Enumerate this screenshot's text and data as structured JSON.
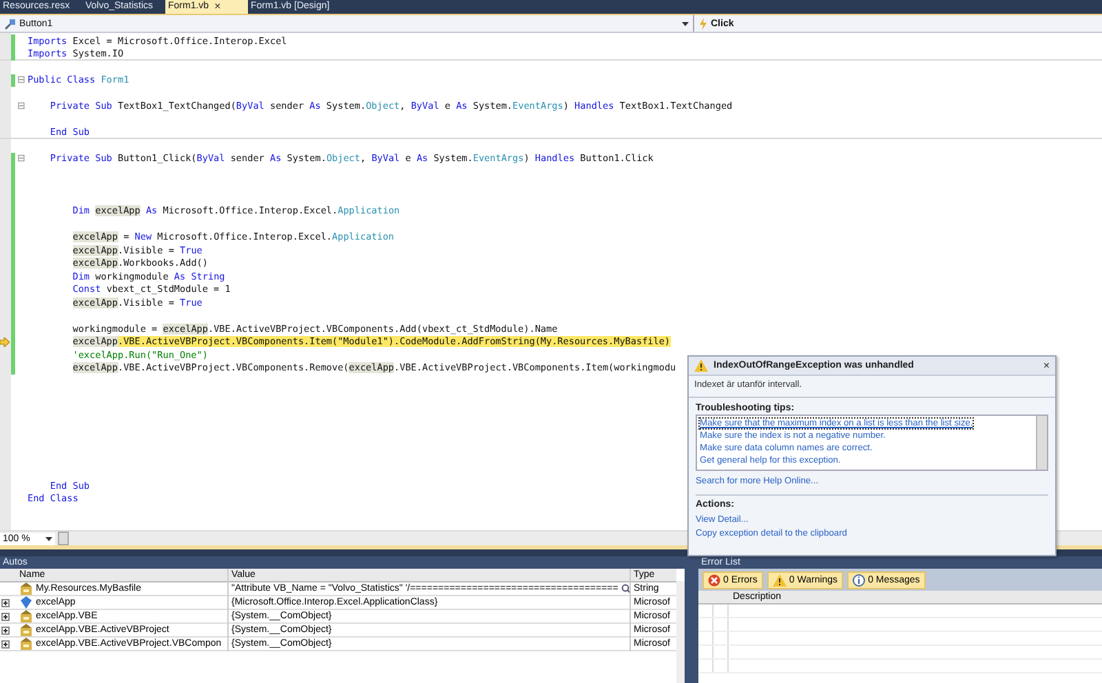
{
  "tabs": [
    {
      "label": "Resources.resx",
      "selected": false
    },
    {
      "label": "Volvo_Statistics",
      "selected": false
    },
    {
      "label": "Form1.vb",
      "selected": true,
      "close": "×"
    },
    {
      "label": "Form1.vb [Design]",
      "selected": false
    }
  ],
  "nav_bar": {
    "object": "Button1",
    "event": "Click"
  },
  "code_lines": [
    {
      "kind": "code",
      "changed": true,
      "segments": [
        {
          "kind": "kw",
          "text": "Imports"
        },
        {
          "kind": "plain",
          "text": " Excel = Microsoft.Office.Interop.Excel"
        }
      ]
    },
    {
      "kind": "code",
      "changed": true,
      "divider_below": true,
      "segments": [
        {
          "kind": "kw",
          "text": "Imports"
        },
        {
          "kind": "plain",
          "text": " System.IO"
        }
      ]
    },
    {
      "kind": "blank"
    },
    {
      "kind": "code",
      "changed": true,
      "outline": "⊟",
      "segments": [
        {
          "kind": "kw",
          "text": "Public Class "
        },
        {
          "kind": "type",
          "text": "Form1"
        }
      ]
    },
    {
      "kind": "blank"
    },
    {
      "kind": "code",
      "outline": "⊟",
      "segments": [
        {
          "kind": "kw",
          "text": "    Private Sub"
        },
        {
          "kind": "plain",
          "text": " TextBox1_TextChanged("
        },
        {
          "kind": "kw",
          "text": "ByVal"
        },
        {
          "kind": "plain",
          "text": " sender "
        },
        {
          "kind": "kw",
          "text": "As"
        },
        {
          "kind": "plain",
          "text": " System."
        },
        {
          "kind": "type",
          "text": "Object"
        },
        {
          "kind": "plain",
          "text": ", "
        },
        {
          "kind": "kw",
          "text": "ByVal"
        },
        {
          "kind": "plain",
          "text": " e "
        },
        {
          "kind": "kw",
          "text": "As"
        },
        {
          "kind": "plain",
          "text": " System."
        },
        {
          "kind": "type",
          "text": "EventArgs"
        },
        {
          "kind": "plain",
          "text": ") "
        },
        {
          "kind": "kw",
          "text": "Handles"
        },
        {
          "kind": "plain",
          "text": " TextBox1.TextChanged"
        }
      ]
    },
    {
      "kind": "blank"
    },
    {
      "kind": "code",
      "divider_below": true,
      "segments": [
        {
          "kind": "kw",
          "text": "    End Sub"
        }
      ]
    },
    {
      "kind": "blank"
    },
    {
      "kind": "code",
      "changed": true,
      "outline": "⊟",
      "segments": [
        {
          "kind": "kw",
          "text": "    Private Sub"
        },
        {
          "kind": "plain",
          "text": " Button1_Click("
        },
        {
          "kind": "kw",
          "text": "ByVal"
        },
        {
          "kind": "plain",
          "text": " sender "
        },
        {
          "kind": "kw",
          "text": "As"
        },
        {
          "kind": "plain",
          "text": " System."
        },
        {
          "kind": "type",
          "text": "Object"
        },
        {
          "kind": "plain",
          "text": ", "
        },
        {
          "kind": "kw",
          "text": "ByVal"
        },
        {
          "kind": "plain",
          "text": " e "
        },
        {
          "kind": "kw",
          "text": "As"
        },
        {
          "kind": "plain",
          "text": " System."
        },
        {
          "kind": "type",
          "text": "EventArgs"
        },
        {
          "kind": "plain",
          "text": ") "
        },
        {
          "kind": "kw",
          "text": "Handles"
        },
        {
          "kind": "plain",
          "text": " Button1.Click"
        }
      ]
    },
    {
      "kind": "blank",
      "changed": true
    },
    {
      "kind": "blank",
      "changed": true
    },
    {
      "kind": "blank",
      "changed": true
    },
    {
      "kind": "code",
      "changed": true,
      "segments": [
        {
          "kind": "kw",
          "text": "        Dim "
        },
        {
          "kind": "ref",
          "text": "excelApp"
        },
        {
          "kind": "kw",
          "text": " As"
        },
        {
          "kind": "plain",
          "text": " Microsoft.Office.Interop.Excel."
        },
        {
          "kind": "type",
          "text": "Application"
        }
      ]
    },
    {
      "kind": "blank",
      "changed": true
    },
    {
      "kind": "code",
      "changed": true,
      "segments": [
        {
          "kind": "ref",
          "text": "        excelApp"
        },
        {
          "kind": "plain",
          "text": " = "
        },
        {
          "kind": "kw",
          "text": "New"
        },
        {
          "kind": "plain",
          "text": " Microsoft.Office.Interop.Excel."
        },
        {
          "kind": "type",
          "text": "Application"
        }
      ]
    },
    {
      "kind": "code",
      "changed": true,
      "segments": [
        {
          "kind": "ref",
          "text": "        excelApp"
        },
        {
          "kind": "plain",
          "text": ".Visible = "
        },
        {
          "kind": "kw",
          "text": "True"
        }
      ]
    },
    {
      "kind": "code",
      "changed": true,
      "segments": [
        {
          "kind": "ref",
          "text": "        excelApp"
        },
        {
          "kind": "plain",
          "text": ".Workbooks.Add()"
        }
      ]
    },
    {
      "kind": "code",
      "changed": true,
      "segments": [
        {
          "kind": "kw",
          "text": "        Dim"
        },
        {
          "kind": "plain",
          "text": " workingmodule "
        },
        {
          "kind": "kw",
          "text": "As String"
        }
      ]
    },
    {
      "kind": "code",
      "changed": true,
      "segments": [
        {
          "kind": "kw",
          "text": "        Const"
        },
        {
          "kind": "plain",
          "text": " vbext_ct_StdModule = 1"
        }
      ]
    },
    {
      "kind": "code",
      "changed": true,
      "segments": [
        {
          "kind": "ref",
          "text": "        excelApp"
        },
        {
          "kind": "plain",
          "text": ".Visible = "
        },
        {
          "kind": "kw",
          "text": "True"
        }
      ]
    },
    {
      "kind": "blank",
      "changed": true
    },
    {
      "kind": "code",
      "changed": true,
      "segments": [
        {
          "kind": "plain",
          "text": "        workingmodule = "
        },
        {
          "kind": "ref",
          "text": "excelApp"
        },
        {
          "kind": "plain",
          "text": ".VBE.ActiveVBProject.VBComponents.Add(vbext_ct_StdModule).Name"
        }
      ]
    },
    {
      "kind": "code",
      "changed": true,
      "current": true,
      "segments": [
        {
          "kind": "ref",
          "text": "        excelApp"
        },
        {
          "kind": "current",
          "text": ".VBE.ActiveVBProject.VBComponents.Item(\"Module1\").CodeModule.AddFromString(My.Resources.MyBasfile)"
        }
      ]
    },
    {
      "kind": "code",
      "changed": true,
      "segments": [
        {
          "kind": "comment",
          "text": "        'excelApp.Run(\"Run_One\")"
        }
      ]
    },
    {
      "kind": "code",
      "changed": true,
      "segments": [
        {
          "kind": "ref",
          "text": "        excelApp"
        },
        {
          "kind": "plain",
          "text": ".VBE.ActiveVBProject.VBComponents.Remove("
        },
        {
          "kind": "ref",
          "text": "excelApp"
        },
        {
          "kind": "plain",
          "text": ".VBE.ActiveVBProject.VBComponents.Item(workingmodu"
        }
      ]
    },
    {
      "kind": "blank"
    },
    {
      "kind": "blank"
    },
    {
      "kind": "blank"
    },
    {
      "kind": "blank"
    },
    {
      "kind": "blank"
    },
    {
      "kind": "blank"
    },
    {
      "kind": "blank"
    },
    {
      "kind": "blank"
    },
    {
      "kind": "code",
      "segments": [
        {
          "kind": "kw",
          "text": "    End Sub"
        }
      ]
    },
    {
      "kind": "code",
      "segments": [
        {
          "kind": "kw",
          "text": "End Class"
        }
      ]
    }
  ],
  "zoom": "100 %",
  "exception": {
    "title": "IndexOutOfRangeException was unhandled",
    "close": "×",
    "message": "Indexet är utanför intervall.",
    "tips_heading": "Troubleshooting tips:",
    "tips": [
      {
        "text": "Make sure that the maximum index on a list is less than the list size.",
        "selected": true
      },
      {
        "text": "Make sure the index is not a negative number.",
        "selected": false
      },
      {
        "text": "Make sure data column names are correct.",
        "selected": false
      },
      {
        "text": "Get general help for this exception.",
        "selected": false
      }
    ],
    "help_link": "Search for more Help Online...",
    "actions_heading": "Actions:",
    "actions": [
      "View Detail...",
      "Copy exception detail to the clipboard"
    ]
  },
  "autos": {
    "title": "Autos",
    "columns": [
      "Name",
      "Value",
      "Type"
    ],
    "rows": [
      {
        "expandable": false,
        "kind": "property",
        "name": "My.Resources.MyBasfile",
        "value": "\"Attribute VB_Name = \"Volvo_Statistics\"  '/=====================================",
        "visualizer": true,
        "type": "String"
      },
      {
        "expandable": true,
        "kind": "field",
        "name": "excelApp",
        "value": "{Microsoft.Office.Interop.Excel.ApplicationClass}",
        "visualizer": false,
        "type": "Microsof"
      },
      {
        "expandable": true,
        "kind": "property",
        "name": "excelApp.VBE",
        "value": "{System.__ComObject}",
        "visualizer": false,
        "type": "Microsof"
      },
      {
        "expandable": true,
        "kind": "property",
        "name": "excelApp.VBE.ActiveVBProject",
        "value": "{System.__ComObject}",
        "visualizer": false,
        "type": "Microsof"
      },
      {
        "expandable": true,
        "kind": "property",
        "name": "excelApp.VBE.ActiveVBProject.VBCompon",
        "value": "{System.__ComObject}",
        "visualizer": false,
        "type": "Microsof"
      }
    ]
  },
  "error_list": {
    "title": "Error List",
    "filters": [
      {
        "kind": "error",
        "label": "0 Errors"
      },
      {
        "kind": "warning",
        "label": "0 Warnings"
      },
      {
        "kind": "info",
        "label": "0 Messages"
      }
    ],
    "columns": [
      "Description"
    ]
  }
}
